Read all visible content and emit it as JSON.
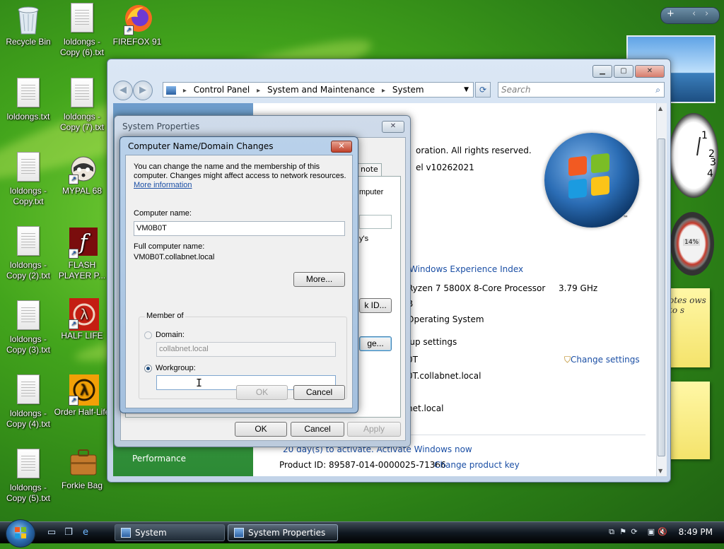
{
  "desktop_icons": [
    {
      "label": "Recycle Bin",
      "icon": "recycle-bin-icon"
    },
    {
      "label": "loldongs - Copy (6).txt",
      "icon": "text-file-icon"
    },
    {
      "label": "FIREFOX 91",
      "icon": "firefox-icon"
    },
    {
      "label": "loldongs.txt",
      "icon": "text-file-icon"
    },
    {
      "label": "loldongs - Copy (7).txt",
      "icon": "text-file-icon"
    },
    {
      "label": "loldongs - Copy.txt",
      "icon": "text-file-icon"
    },
    {
      "label": "MYPAL 68",
      "icon": "raccoon-icon"
    },
    {
      "label": "loldongs - Copy (2).txt",
      "icon": "text-file-icon"
    },
    {
      "label": "FLASH PLAYER P...",
      "icon": "flash-icon"
    },
    {
      "label": "loldongs - Copy (3).txt",
      "icon": "text-file-icon"
    },
    {
      "label": "HALF LIFE",
      "icon": "half-life-icon"
    },
    {
      "label": "loldongs - Copy (4).txt",
      "icon": "text-file-icon"
    },
    {
      "label": "Order Half-Life",
      "icon": "half-life-icon"
    },
    {
      "label": "loldongs - Copy (5).txt",
      "icon": "text-file-icon"
    },
    {
      "label": "Forkie Bag",
      "icon": "briefcase-icon"
    }
  ],
  "sidebar": {
    "top_buttons": [
      "+",
      "‹",
      "›"
    ],
    "gauge_text": "14%",
    "note_text": "otes ows to s"
  },
  "control_panel": {
    "breadcrumb": [
      "Control Panel",
      "System and Maintenance",
      "System"
    ],
    "search_placeholder": "Search",
    "left_item": "Performance",
    "main": {
      "copyright": "oration.  All rights reserved.",
      "version": "el v10262021",
      "wei_link": "Windows Experience Index",
      "processor_name": "Ryzen 7 5800X 8-Core Processor",
      "processor_speed": "3.79 GHz",
      "ram": "B",
      "system_type": "Operating System",
      "group_heading": "oup settings",
      "change_settings": "Change settings",
      "computer_name": "0T",
      "full_name": "0T.collabnet.local",
      "domain": "net.local",
      "activation": "20 day(s) to activate. Activate Windows now",
      "product_id": "Product ID: 89587-014-0000025-71366",
      "change_key": "Change product key"
    }
  },
  "system_properties": {
    "title": "System Properties",
    "tab_remote": "note",
    "frag_computer": "mputer",
    "frag_ys": "y's",
    "frag_id_btn": "k ID...",
    "frag_change_btn": "ge...",
    "ok": "OK",
    "cancel": "Cancel",
    "apply": "Apply"
  },
  "name_dialog": {
    "title": "Computer Name/Domain Changes",
    "intro_line1": "You can change the name and the membership of this",
    "intro_line2": "computer. Changes might affect access to network resources.",
    "more_info": "More information",
    "computer_name_label": "Computer name:",
    "computer_name_value": "VM0B0T",
    "full_name_label": "Full computer name:",
    "full_name_value": "VM0B0T.collabnet.local",
    "more_button": "More...",
    "member_of": "Member of",
    "domain_label": "Domain:",
    "domain_value": "collabnet.local",
    "workgroup_label": "Workgroup:",
    "workgroup_value": "",
    "ok": "OK",
    "cancel": "Cancel"
  },
  "taskbar": {
    "tasks": [
      "System",
      "System Properties"
    ],
    "time": "8:49 PM"
  }
}
